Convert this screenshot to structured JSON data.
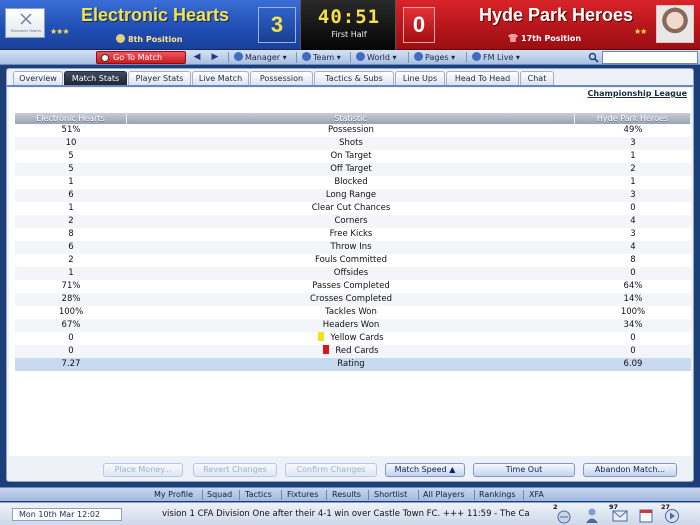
{
  "scoreboard": {
    "home": {
      "badge_text": "Electronic Hearts",
      "name": "Electronic Hearts",
      "stars": "★★★",
      "position": "8th Position",
      "score": "3"
    },
    "clock": {
      "time": "40:51",
      "period": "First Half"
    },
    "away": {
      "name": "Hyde Park Heroes",
      "stars": "★★",
      "position": "17th Position",
      "score": "0"
    }
  },
  "nav": {
    "goto_match": "Go To Match",
    "menus": [
      "Manager",
      "Team",
      "World",
      "Pages",
      "FM Live"
    ],
    "search_placeholder": ""
  },
  "tabs": [
    "Overview",
    "Match Stats",
    "Player Stats",
    "Live Match",
    "Possession",
    "Tactics & Subs",
    "Line Ups",
    "Head To Head",
    "Chat"
  ],
  "active_tab": "Match Stats",
  "competition": "Championship League",
  "table": {
    "headers": {
      "home": "Electronic Hearts",
      "stat": "Statistic",
      "away": "Hyde Park Heroes"
    },
    "rows": [
      {
        "home": "51%",
        "stat": "Possession",
        "away": "49%"
      },
      {
        "home": "10",
        "stat": "Shots",
        "away": "3"
      },
      {
        "home": "5",
        "stat": "On Target",
        "away": "1"
      },
      {
        "home": "5",
        "stat": "Off Target",
        "away": "2"
      },
      {
        "home": "1",
        "stat": "Blocked",
        "away": "1"
      },
      {
        "home": "6",
        "stat": "Long Range",
        "away": "3"
      },
      {
        "home": "1",
        "stat": "Clear Cut Chances",
        "away": "0"
      },
      {
        "home": "2",
        "stat": "Corners",
        "away": "4"
      },
      {
        "home": "8",
        "stat": "Free Kicks",
        "away": "3"
      },
      {
        "home": "6",
        "stat": "Throw Ins",
        "away": "4"
      },
      {
        "home": "2",
        "stat": "Fouls Committed",
        "away": "8"
      },
      {
        "home": "1",
        "stat": "Offsides",
        "away": "0"
      },
      {
        "home": "71%",
        "stat": "Passes Completed",
        "away": "64%"
      },
      {
        "home": "28%",
        "stat": "Crosses Completed",
        "away": "14%"
      },
      {
        "home": "100%",
        "stat": "Tackles Won",
        "away": "100%"
      },
      {
        "home": "67%",
        "stat": "Headers Won",
        "away": "34%"
      },
      {
        "home": "0",
        "stat": "Yellow Cards",
        "away": "0"
      },
      {
        "home": "0",
        "stat": "Red Cards",
        "away": "0"
      },
      {
        "home": "7.27",
        "stat": "Rating",
        "away": "6.09"
      }
    ]
  },
  "bottom_buttons": [
    {
      "label": "Place Money...",
      "enabled": false
    },
    {
      "label": "Revert Changes",
      "enabled": false
    },
    {
      "label": "Confirm Changes",
      "enabled": false
    },
    {
      "label": "Match Speed ▲",
      "enabled": true
    },
    {
      "label": "Time Out",
      "enabled": true
    },
    {
      "label": "Abandon Match...",
      "enabled": true
    }
  ],
  "bottom_nav": [
    "My Profile",
    "Squad",
    "Tactics",
    "Fixtures",
    "Results",
    "Shortlist",
    "All Players",
    "Rankings",
    "XFA"
  ],
  "status": {
    "date": "Mon 10th Mar 12:02",
    "ticker": "vision 1 CFA Division One after their 4-1 win over Castle Town FC.   +++   11:59 - The Ca",
    "badges": [
      "2",
      "97",
      "27"
    ]
  },
  "colors": {
    "home": "#1f4db3",
    "away": "#c0181e",
    "accent": "#f5e14a"
  }
}
